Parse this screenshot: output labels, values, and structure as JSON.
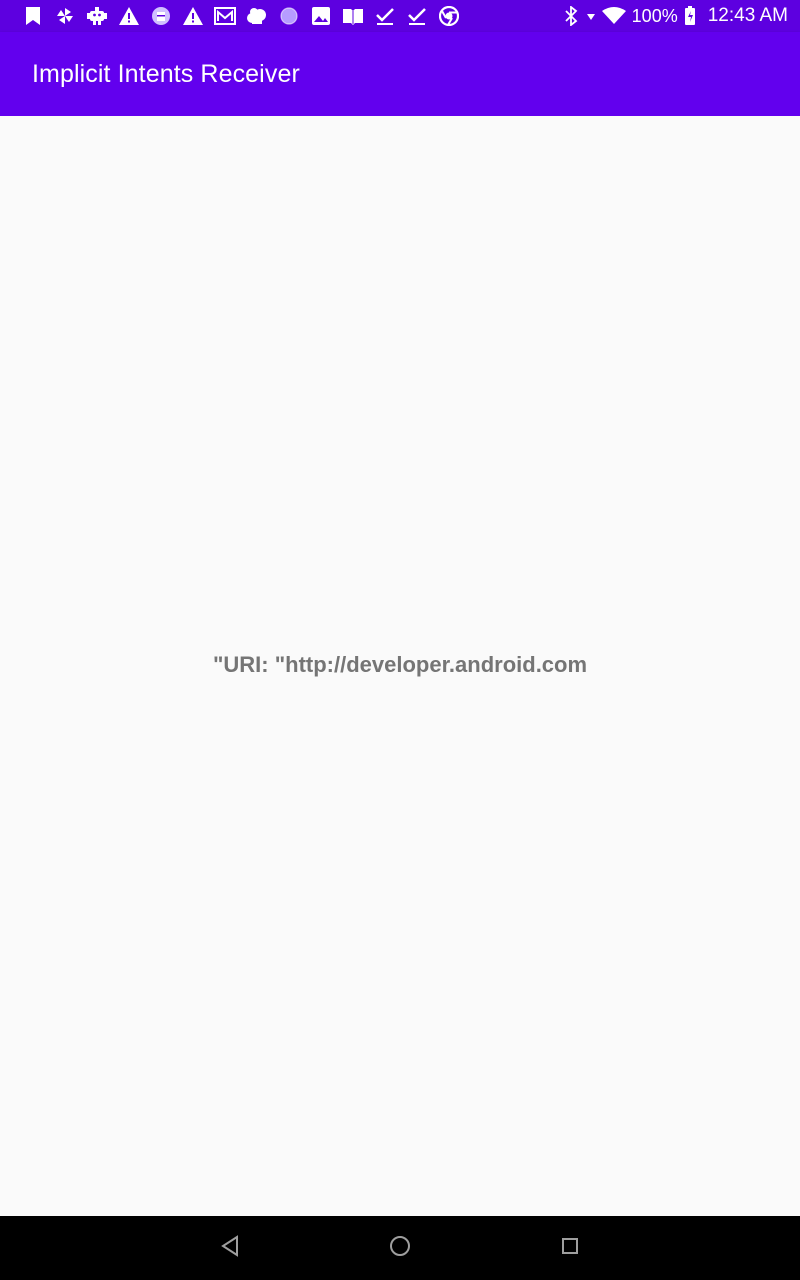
{
  "status_bar": {
    "notification_icons": [
      "bookmark-icon",
      "pinwheel-icon",
      "robot-icon",
      "warning-icon",
      "sd-card-icon",
      "warning-icon",
      "mail-icon",
      "cloud-icon",
      "circle-icon",
      "image-icon",
      "book-icon",
      "checkmark-icon",
      "checkmark-icon",
      "chrome-icon"
    ],
    "battery_percent": "100%",
    "time": "12:43 AM"
  },
  "app_bar": {
    "title": "Implicit Intents Receiver"
  },
  "main": {
    "uri_text": "\"URI: \"http://developer.android.com"
  },
  "nav_bar": {
    "buttons": [
      "back-icon",
      "home-icon",
      "recents-icon"
    ]
  },
  "colors": {
    "status_bar": "#5d00e0",
    "app_bar": "#6200ee",
    "background": "#fafafa",
    "text_secondary": "#757575",
    "nav_bar": "#000000"
  }
}
